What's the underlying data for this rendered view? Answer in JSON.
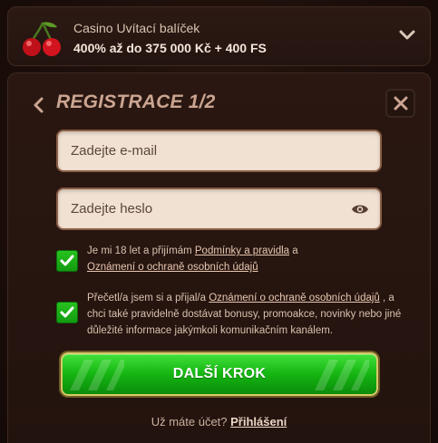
{
  "bonus": {
    "line1": "Casino Uvítací balíček",
    "line2": "400% až do 375 000 Kč + 400 FS"
  },
  "form": {
    "title": "REGISTRACE 1/2",
    "email_placeholder": "Zadejte e-mail",
    "password_placeholder": "Zadejte heslo",
    "consent1": {
      "prefix": "Je mi 18 let a přijímám ",
      "link1": "Podmínky a pravidla",
      "mid": " a",
      "link2": "Oznámení o ochraně osobních údajů"
    },
    "consent2": {
      "prefix": "Přečetl/a jsem si a přijal/a ",
      "link": "Oznámení o ochraně osobních údajů",
      "suffix": " , a chci také pravidelně dostávat bonusy, promoakce, novinky nebo jiné důležité informace jakýmkoli komunikačním kanálem."
    },
    "cta_label": "DALŠÍ KROK",
    "login_prompt": "Už máte účet? ",
    "login_link": "Přihlášení"
  },
  "colors": {
    "accent_green": "#15b512",
    "title": "#cba591",
    "field_bg": "#f1e1d3"
  },
  "icons": [
    "cherry-icon",
    "chevron-down-icon",
    "back-arrow-icon",
    "close-icon",
    "eye-icon",
    "checkmark-icon"
  ]
}
